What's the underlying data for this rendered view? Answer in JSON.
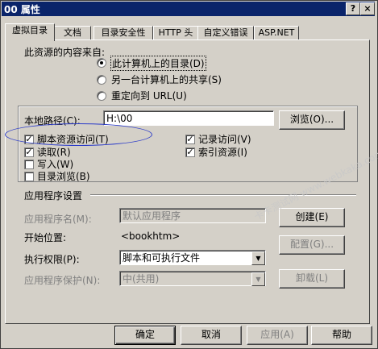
{
  "window": {
    "title": "00 属性",
    "help_btn": "?",
    "close_btn": "×"
  },
  "tabs": [
    "虚拟目录",
    "文档",
    "目录安全性",
    "HTTP 头",
    "自定义错误",
    "ASP.NET"
  ],
  "source": {
    "heading": "此资源的内容来自:",
    "options": [
      "此计算机上的目录(D)",
      "另一台计算机上的共享(S)",
      "重定向到 URL(U)"
    ],
    "selected": 0
  },
  "path": {
    "label": "本地路径(C):",
    "value": "H:\\00",
    "browse": "浏览(O)..."
  },
  "perms": {
    "script_source": "脚本资源访问(T)",
    "read": "读取(R)",
    "write": "写入(W)",
    "dir_browse": "目录浏览(B)",
    "log_visits": "记录访问(V)",
    "index": "索引资源(I)",
    "checked": {
      "script_source": true,
      "read": true,
      "write": false,
      "dir_browse": false,
      "log_visits": true,
      "index": true
    }
  },
  "app": {
    "heading": "应用程序设置",
    "name_label": "应用程序名(M):",
    "name_value": "默认应用程序",
    "create_btn": "创建(E)",
    "start_label": "开始位置:",
    "start_value": "<bookhtm>",
    "config_btn": "配置(G)...",
    "exec_label": "执行权限(P):",
    "exec_value": "脚本和可执行文件",
    "protect_label": "应用程序保护(N):",
    "protect_value": "中(共用)",
    "unload_btn": "卸载(L)"
  },
  "footer": {
    "ok": "确定",
    "cancel": "取消",
    "apply": "应用(A)",
    "help": "帮助"
  },
  "watermark": "卡卡测试网 www.webkaka.com"
}
